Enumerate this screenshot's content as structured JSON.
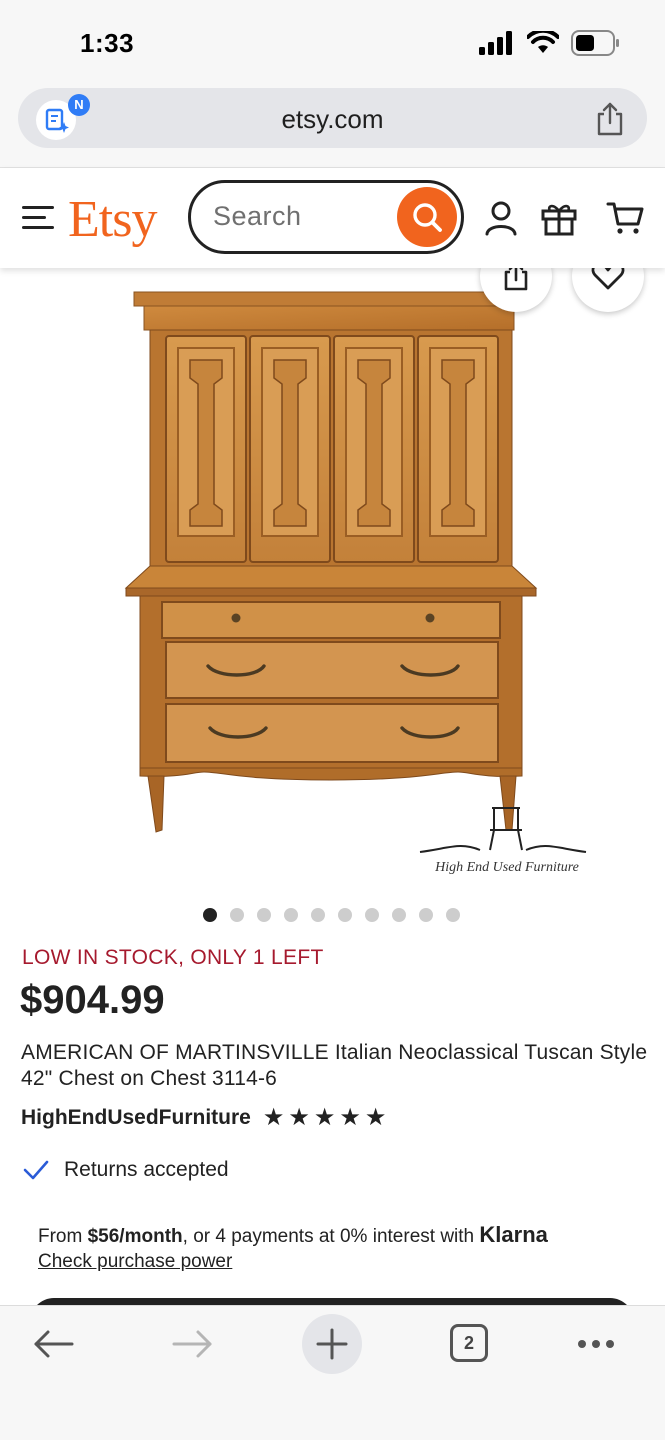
{
  "status_bar": {
    "time": "1:33"
  },
  "browser": {
    "url": "etsy.com",
    "extension_badge": "N"
  },
  "etsy_header": {
    "logo": "Etsy",
    "search_placeholder": "Search"
  },
  "product": {
    "watermark": "High End Used Furniture",
    "image_count": 10,
    "active_image_index": 0,
    "stock_notice": "LOW IN STOCK, ONLY 1 LEFT",
    "price": "$904.99",
    "title": "AMERICAN OF MARTINSVILLE Italian Neoclassical Tuscan Style 42\" Chest on Chest 3114-6",
    "shop_name": "HighEndUsedFurniture",
    "rating_stars": 5,
    "returns": "Returns accepted",
    "klarna": {
      "prefix": "From ",
      "amount": "$56/month",
      "middle": ", or 4 payments at 0% interest with ",
      "brand": "Klarna",
      "link": "Check purchase power"
    }
  },
  "toolbar": {
    "tab_count": "2"
  },
  "colors": {
    "etsy_orange": "#f1641e",
    "stock_red": "#a61a2e",
    "check_blue": "#2a5bd7"
  }
}
